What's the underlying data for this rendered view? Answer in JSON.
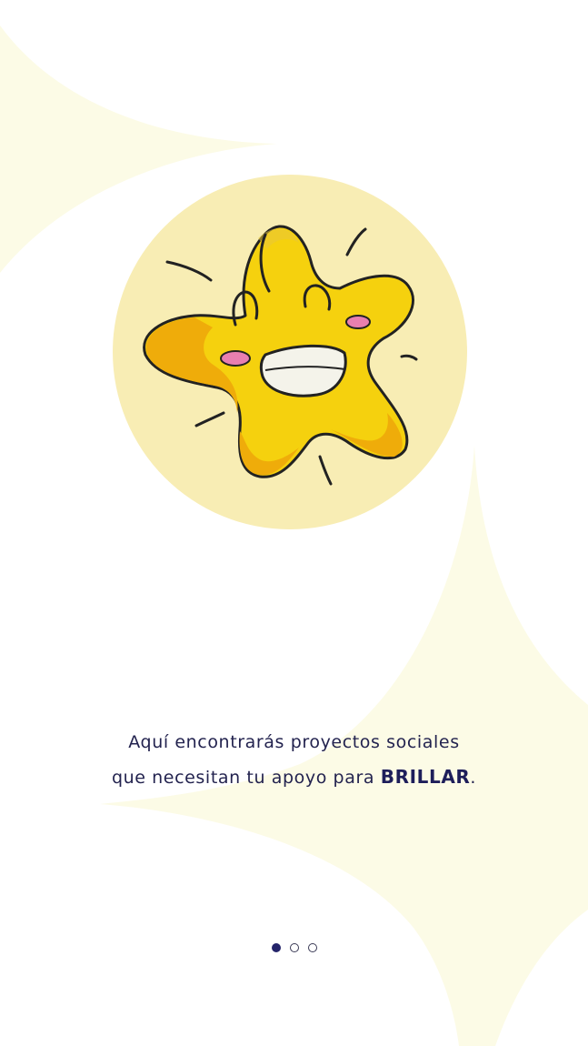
{
  "colors": {
    "background": "#ffffff",
    "decor_shape": "#fcfbe6",
    "circle": "#f8edb4",
    "star_light": "#f5d10e",
    "star_dark": "#efac0a",
    "text": "#23234f",
    "dot_active": "#24246a"
  },
  "illustration": {
    "icon": "smiling-star-mascot-icon"
  },
  "message": {
    "line1": "Aquí encontrarás proyectos sociales",
    "line2_prefix": "que necesitan tu apoyo para ",
    "line2_highlight": "BRILLAR",
    "line2_suffix": "."
  },
  "pager": {
    "pages": 3,
    "active_index": 0
  }
}
